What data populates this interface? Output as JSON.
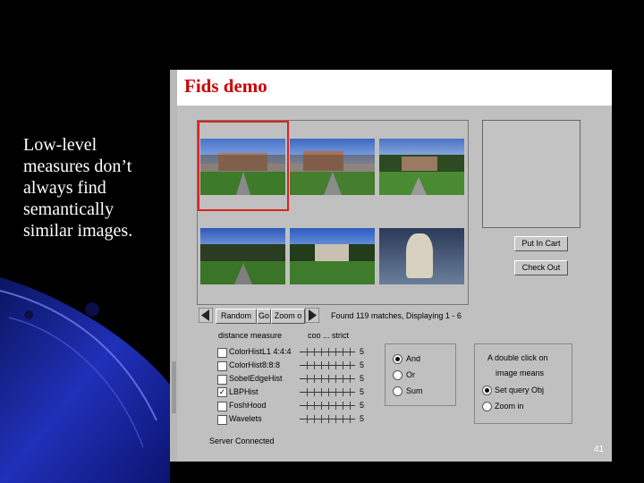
{
  "slide": {
    "caption": "Low-level measures don’t always find semantically similar images.",
    "page_number": "41"
  },
  "app": {
    "title": "Fids demo",
    "buttons": {
      "put_in_cart": "Put In Cart",
      "check_out": "Check Out",
      "random": "Random",
      "go": "Go",
      "zoom": "Zoom o"
    },
    "status_text": "Found 119 matches, Displaying 1 - 6",
    "distance_measure_label": "distance measure",
    "weight_label": "coo ... strict",
    "measures": [
      {
        "label": "ColorHistL1 4:4:4",
        "checked": false,
        "value": "5"
      },
      {
        "label": "ColorHist8:8:8",
        "checked": false,
        "value": "5"
      },
      {
        "label": "SobelEdgeHist",
        "checked": false,
        "value": "5"
      },
      {
        "label": "LBPHist",
        "checked": true,
        "value": "5"
      },
      {
        "label": "FoshHood",
        "checked": false,
        "value": "5"
      },
      {
        "label": "Wavelets",
        "checked": false,
        "value": "5"
      }
    ],
    "combine_options": [
      {
        "label": "And",
        "selected": true
      },
      {
        "label": "Or",
        "selected": false
      },
      {
        "label": "Sum",
        "selected": false
      }
    ],
    "double_click": {
      "line1": "A double click on",
      "line2": "image means",
      "options": [
        {
          "label": "Set query Obj",
          "selected": true
        },
        {
          "label": "Zoom in",
          "selected": false
        }
      ]
    },
    "server_status": "Server Connected"
  },
  "colors": {
    "title_red": "#cc0000",
    "selection_red": "#e02020",
    "panel_gray": "#c0c0c0",
    "slide_blue": "#1a2a9a"
  }
}
